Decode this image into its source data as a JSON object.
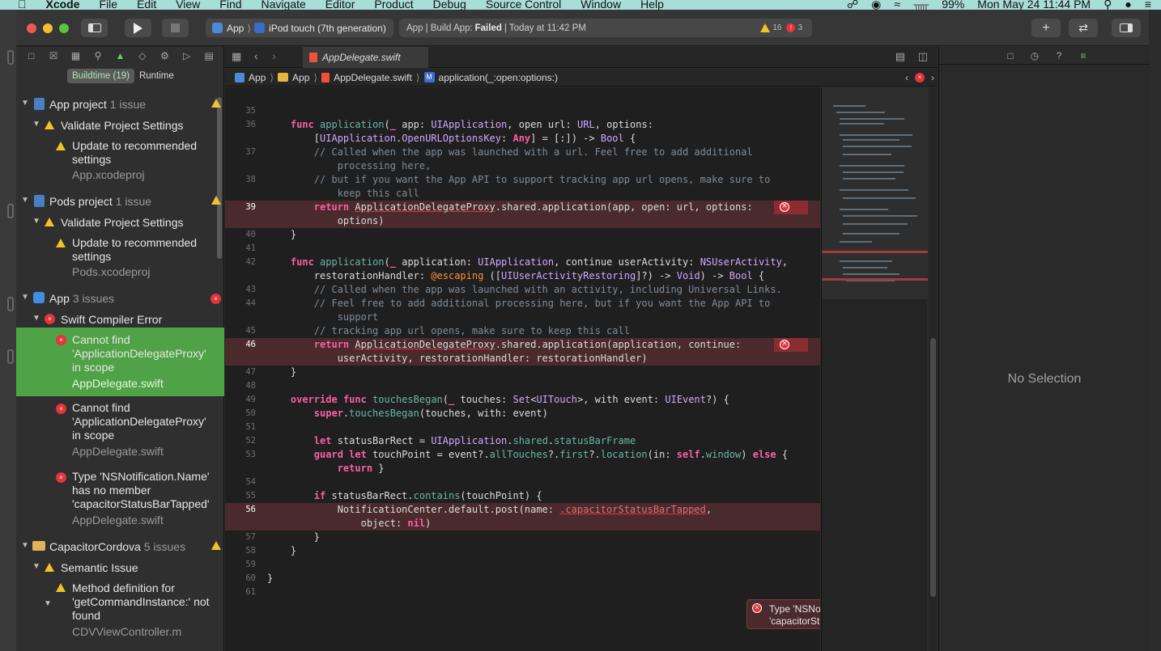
{
  "menubar": {
    "app_name": "Xcode",
    "items": [
      "File",
      "Edit",
      "View",
      "Find",
      "Navigate",
      "Editor",
      "Product",
      "Debug",
      "Source Control",
      "Window",
      "Help"
    ],
    "battery": "99%",
    "datetime": "Mon May 24  11:44 PM"
  },
  "toolbar": {
    "scheme_target": "App",
    "scheme_device": "iPod touch (7th generation)",
    "status_prefix": "App | Build App:",
    "status_result": "Failed",
    "status_time": "| Today at 11:42 PM",
    "warnings_count": "16",
    "errors_count": "3",
    "add_label": "+",
    "swap_label": "⇄"
  },
  "navigator": {
    "segments": {
      "buildtime": "Buildtime (19)",
      "runtime": "Runtime"
    },
    "groups": [
      {
        "name": "App project",
        "count": "1 issue",
        "sub": {
          "name": "Validate Project Settings",
          "items": [
            {
              "l1": "Update to recommended",
              "l2": "settings",
              "file": "App.xcodeproj"
            }
          ]
        }
      },
      {
        "name": "Pods project",
        "count": "1 issue",
        "sub": {
          "name": "Validate Project Settings",
          "items": [
            {
              "l1": "Update to recommended",
              "l2": "settings",
              "file": "Pods.xcodeproj"
            }
          ]
        }
      },
      {
        "name": "App",
        "count": "3 issues",
        "sub": {
          "name": "Swift Compiler Error",
          "items": [
            {
              "l1": "Cannot find",
              "l2": "'ApplicationDelegateProxy'",
              "l3": "in scope",
              "file": "AppDelegate.swift"
            },
            {
              "l1": "Cannot find",
              "l2": "'ApplicationDelegateProxy'",
              "l3": "in scope",
              "file": "AppDelegate.swift"
            },
            {
              "l1": "Type 'NSNotification.Name'",
              "l2": "has no member",
              "l3": "'capacitorStatusBarTapped'",
              "file": "AppDelegate.swift"
            }
          ]
        }
      },
      {
        "name": "CapacitorCordova",
        "count": "5 issues",
        "sub": {
          "name": "Semantic Issue",
          "items": [
            {
              "l1": "Method definition for",
              "l2": "'getCommandInstance:' not",
              "l3": "found",
              "file": "CDVViewController.m"
            }
          ]
        }
      }
    ]
  },
  "editor": {
    "tab_title": "AppDelegate.swift",
    "breadcrumb": [
      "App",
      "App",
      "AppDelegate.swift",
      "application(_:open:options:)"
    ],
    "popover_line1": "Type 'NSNotification.Name' has no member",
    "popover_line2": "'capacitorStatusBarTapped'",
    "popover_close": "×",
    "line_numbers": [
      "35",
      "36",
      "37",
      "38",
      "39",
      "40",
      "41",
      "42",
      "43",
      "44",
      "45",
      "46",
      "47",
      "48",
      "49",
      "50",
      "51",
      "52",
      "53",
      "54",
      "55",
      "56",
      "57",
      "58",
      "59",
      "60",
      "61"
    ]
  },
  "inspector": {
    "empty_text": "No Selection"
  },
  "colors": {
    "selection": "#4fa346",
    "error": "#e5343b",
    "warning": "#f2c229",
    "menubar": "#a9ddd7"
  }
}
